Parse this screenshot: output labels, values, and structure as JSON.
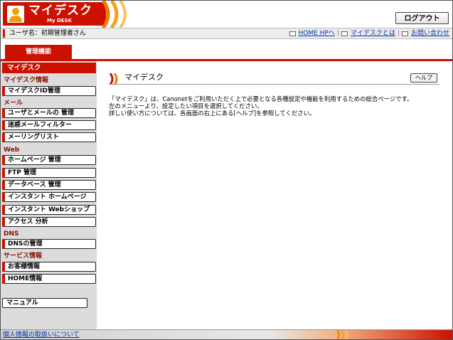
{
  "header": {
    "app_title": "マイデスク",
    "app_subtitle": "My DESK",
    "logout_label": "ログアウト"
  },
  "userbar": {
    "user_label": "ユーザ名：初期管理者さん",
    "links": [
      "HOME HPへ",
      "マイデスクとは",
      "お問い合わせ"
    ]
  },
  "tabs": {
    "active": "管理機能"
  },
  "sidebar": {
    "heading": "マイデスク",
    "categories": {
      "mydesk_info": "マイデスク情報",
      "mail": "メール",
      "web": "Web",
      "dns": "DNS",
      "service_info": "サービス情報"
    },
    "items": {
      "mydesk_id": "マイデスクID管理",
      "user_mail": "ユーザとメールの 管理",
      "spam_filter": "迷惑メールフィルター",
      "mailing_list": "メーリングリスト",
      "homepage": "ホームページ 管理",
      "ftp": "FTP 管理",
      "database": "データベース 管理",
      "instant_hp": "インスタント ホームページ",
      "instant_shop": "インスタント Webショップ",
      "access": "アクセス 分析",
      "dns_manage": "DNSの管理",
      "customer": "お客様情報",
      "home_info": "HOME情報"
    },
    "manual": "マニュアル"
  },
  "main": {
    "title": "マイデスク",
    "help_label": "ヘルプ",
    "description": [
      "「マイデスク」は、Canonetをご利用いただく上で必要となる各種設定や機能を利用するための総合ページです。",
      "左のメニューより、設定したい項目を選択してください。",
      "詳しい使い方については、各画面の右上にある[ヘルプ]を参照してください。"
    ]
  },
  "footer": {
    "privacy_link": "個人情報の取扱いについて"
  },
  "colors": {
    "accent": "#cc1100",
    "link": "#0033aa",
    "sidebar_bg": "#dcdcdc"
  }
}
